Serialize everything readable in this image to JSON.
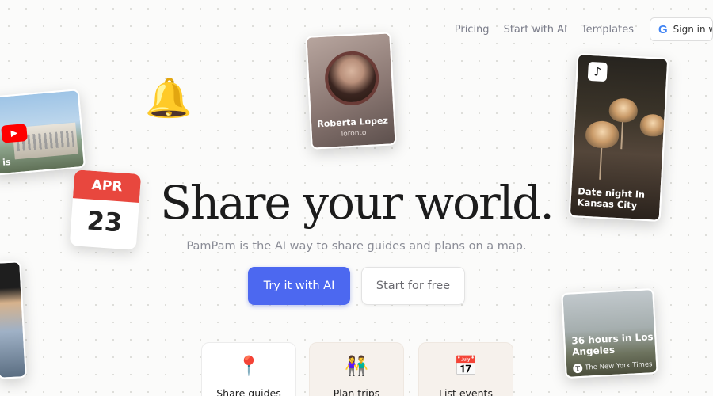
{
  "nav": {
    "links": [
      "Pricing",
      "Start with AI",
      "Templates"
    ],
    "signin_label": "Sign in wi",
    "google_icon": "G"
  },
  "hero": {
    "title": "Share your world.",
    "subtitle": "PamPam is the AI way to share guides and plans on a map.",
    "primary_button": "Try it with AI",
    "secondary_button": "Start for free"
  },
  "features": [
    {
      "label": "Share guides",
      "icon": "📍"
    },
    {
      "label": "Plan trips",
      "icon": "👫"
    },
    {
      "label": "List events",
      "icon": "📅"
    }
  ],
  "cards": {
    "profile": {
      "name": "Roberta Lopez",
      "location": "Toronto"
    },
    "tiktok": {
      "caption": "Date night in Kansas City",
      "icon": "♪"
    },
    "youtube": {
      "caption": "is",
      "icon": "▶"
    },
    "calendar": {
      "month": "APR",
      "day": "23"
    },
    "bell": {
      "icon": "🔔"
    },
    "la": {
      "caption": "36 hours in Los Angeles",
      "source": "The New York Times",
      "source_icon": "T"
    }
  },
  "colors": {
    "primary": "#4c68f0",
    "calendar_red": "#e8473e",
    "youtube_red": "#ff0000"
  }
}
